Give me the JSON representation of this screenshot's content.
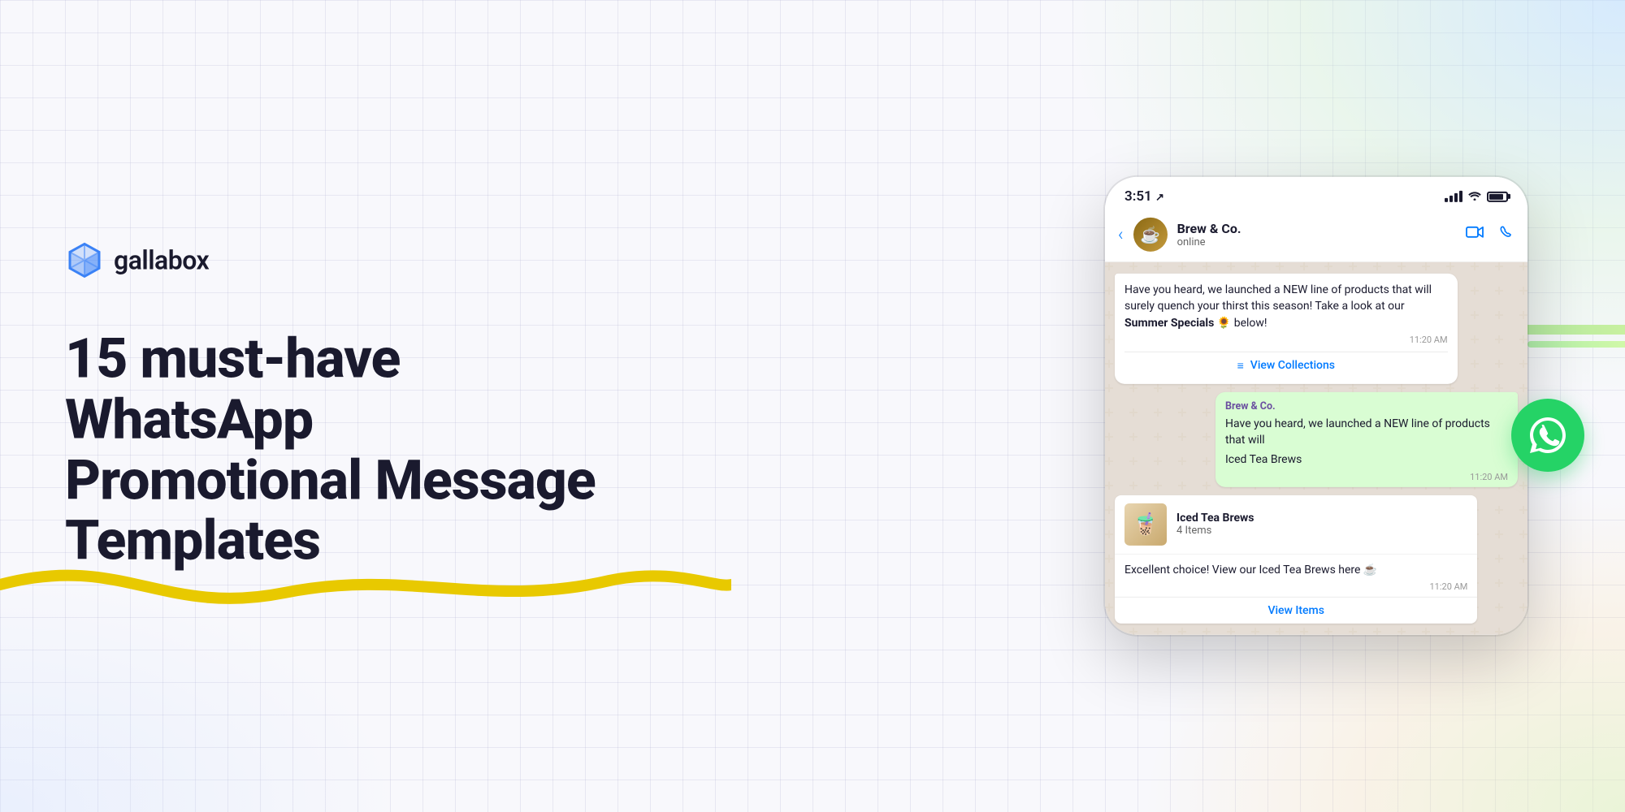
{
  "brand": {
    "name": "gallabox",
    "logo_alt": "Gallabox cube logo"
  },
  "headline": {
    "line1": "15 must-have WhatsApp",
    "line2": "Promotional Message",
    "line3": "Templates"
  },
  "phone": {
    "status_bar": {
      "time": "3:51",
      "time_icon": "↗"
    },
    "chat_header": {
      "contact_name": "Brew & Co.",
      "status": "online",
      "avatar_emoji": "☕"
    },
    "messages": [
      {
        "type": "received",
        "text": "Have you heard, we launched a NEW line of products that will surely quench your thirst this season! Take a look at our ",
        "bold_part": "Summer Specials 🌻",
        "text_after": " below!",
        "time": "11:20 AM",
        "button_label": "View Collections",
        "button_icon": "≡"
      },
      {
        "type": "sent",
        "sender": "Brew & Co.",
        "text": "Have you heard, we launched a NEW line of products that will",
        "italic_part": "Iced Tea Brews",
        "time": "11:20 AM"
      }
    ],
    "catalog_card": {
      "title": "Iced Tea Brews",
      "count": "4 Items",
      "thumb_emoji": "🧋",
      "description": "Excellent choice! View our Iced Tea Brews here ☕",
      "time": "11:20 AM",
      "cta_label": "View Items"
    }
  },
  "whatsapp_icon": "whatsapp-icon",
  "wave_color": "#E8C900"
}
